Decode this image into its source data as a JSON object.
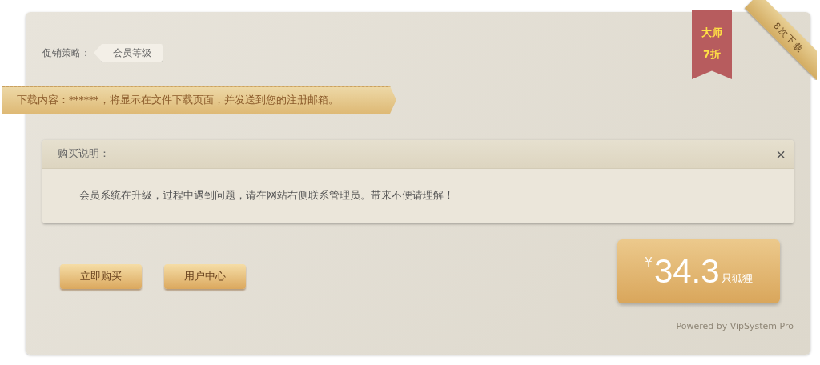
{
  "promotion": {
    "label": "促销策略：",
    "tag": "会员等级"
  },
  "download_ribbon": {
    "text": "下载内容：******，将显示在文件下载页面，并发送到您的注册邮箱。"
  },
  "discount_badge": {
    "line_1": "大师",
    "line_2": "7折"
  },
  "downloads_ribbon": {
    "text": "8次下载"
  },
  "notice": {
    "title": "购买说明：",
    "close": "×",
    "message": "会员系统在升级，过程中遇到问题，请在网站右侧联系管理员。带来不便请理解！"
  },
  "buttons": [
    "立即购买",
    "用户中心"
  ],
  "price": {
    "currency": "¥",
    "amount": "34.3",
    "unit": "只狐狸"
  },
  "footer": "Powered by VipSystem Pro"
}
